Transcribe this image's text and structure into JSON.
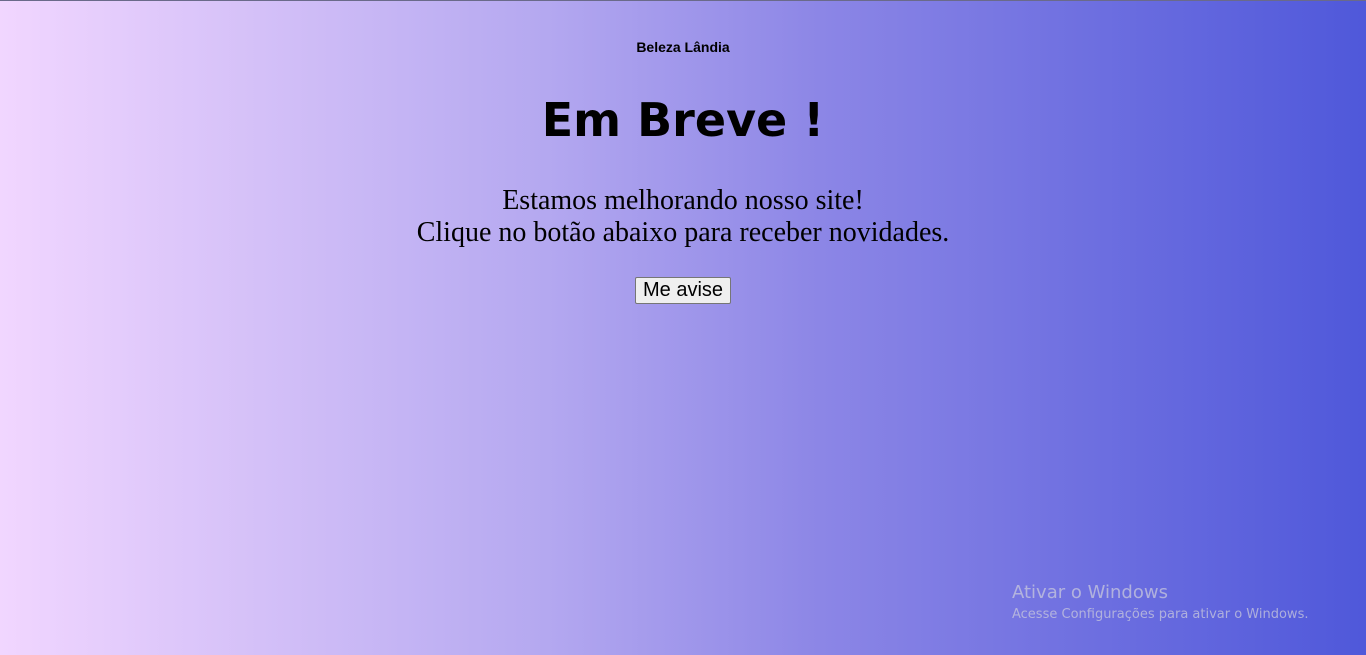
{
  "header": {
    "brand": "Beleza Lândia"
  },
  "main": {
    "title": "Em Breve !",
    "message_line1": "Estamos melhorando nosso site!",
    "message_line2": "Clique no botão abaixo para receber novidades.",
    "notify_button": "Me avise"
  },
  "watermark": {
    "title": "Ativar o Windows",
    "subtitle": "Acesse Configurações para ativar o Windows."
  }
}
